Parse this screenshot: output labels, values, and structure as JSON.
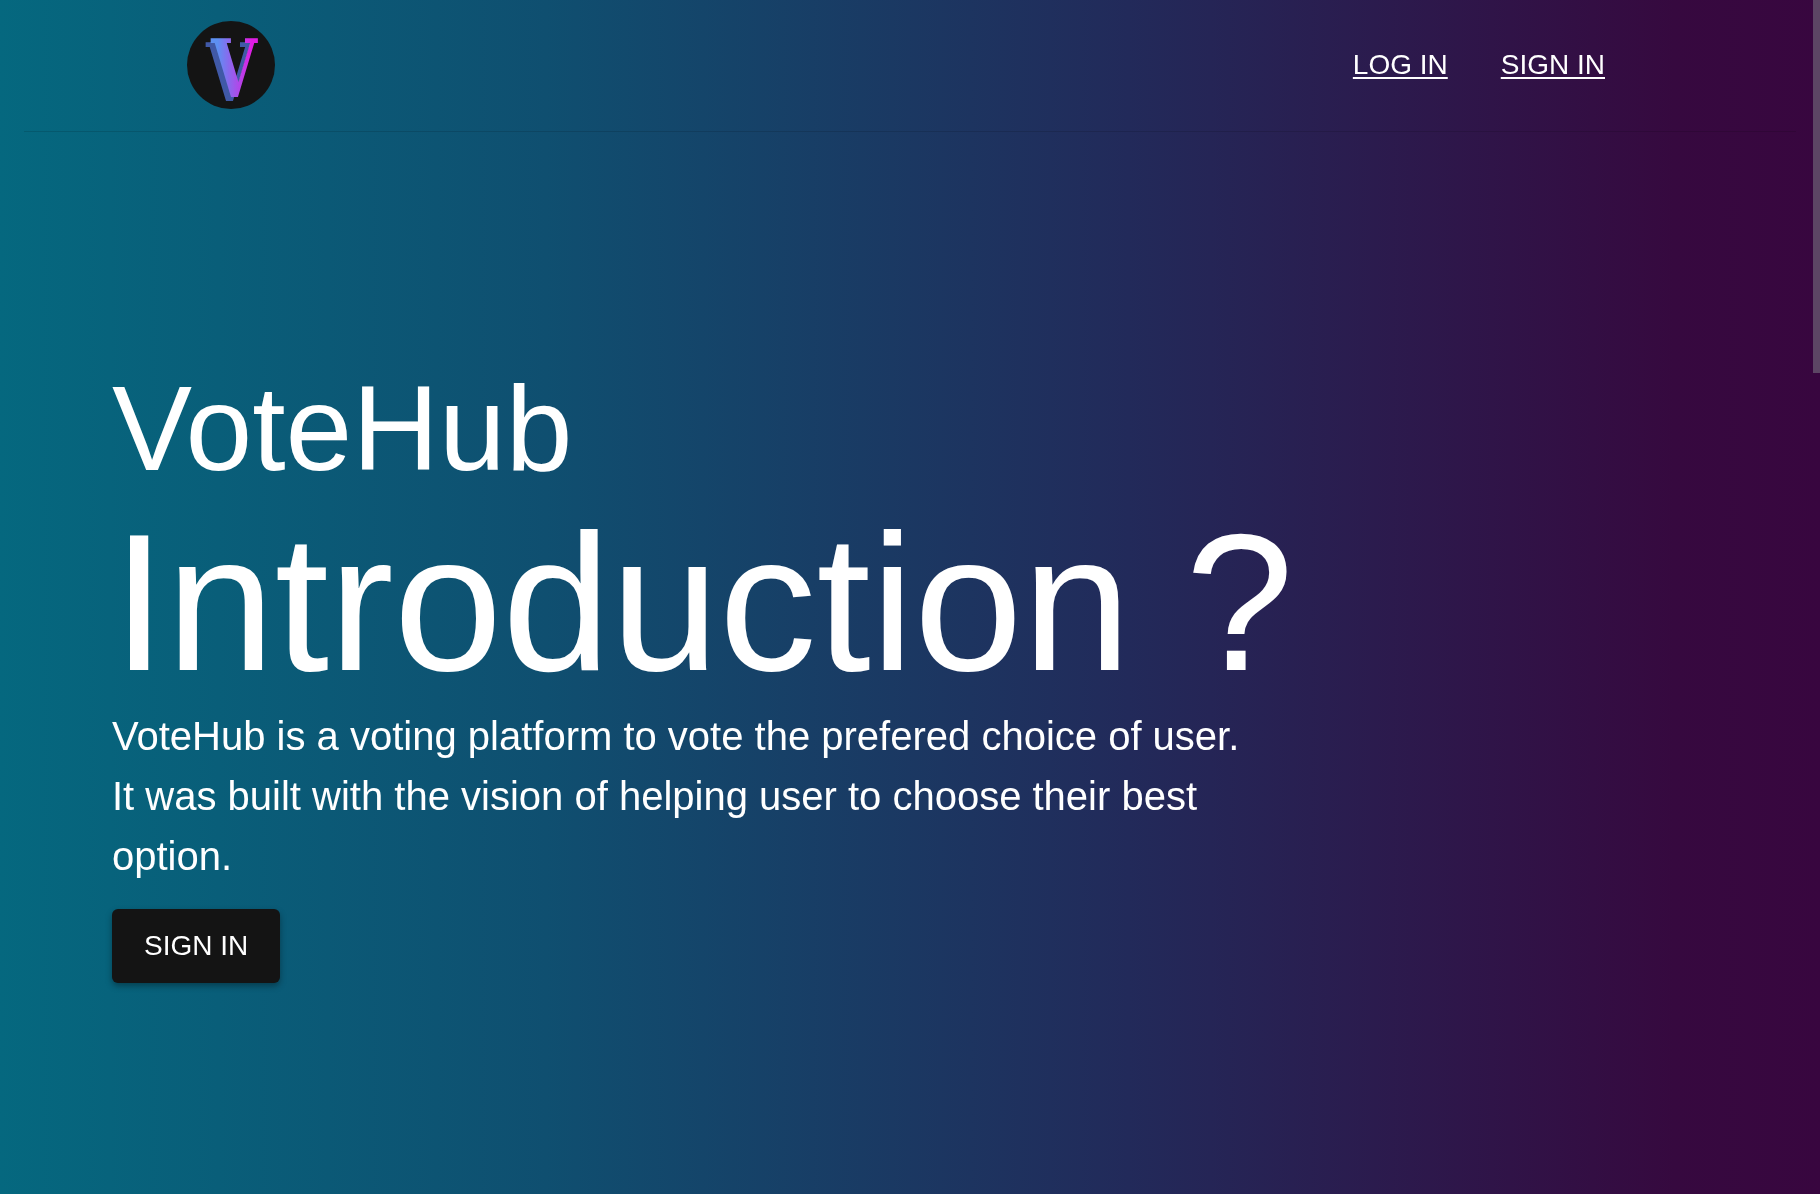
{
  "header": {
    "logo": {
      "letter": "V"
    },
    "nav_links": [
      "LOG IN",
      "SIGN IN"
    ]
  },
  "hero": {
    "brand": "VoteHub",
    "headline": "Introduction ?",
    "description": "VoteHub is a voting platform to vote the prefered choice of user. It was built with the vision of helping user to choose their best option.",
    "button": "SIGN IN"
  }
}
